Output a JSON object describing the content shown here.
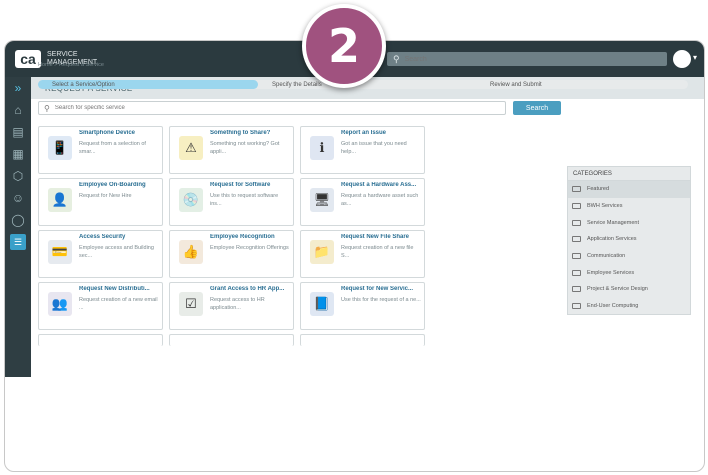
{
  "brand": {
    "logo": "ca",
    "name": "SERVICE MANAGEMENT"
  },
  "global_search": {
    "placeholder": "Search"
  },
  "step_badge": "2",
  "sidebar_icons": [
    "chevron-right-icon",
    "home-icon",
    "document-icon",
    "book-icon",
    "box-icon",
    "users-icon",
    "chat-icon",
    "catalog-icon"
  ],
  "page": {
    "title": "REQUEST A SERVICE",
    "breadcrumb": "Home > Request a Service"
  },
  "steps": [
    "Select a Service/Option",
    "Specify the Details",
    "Review and Submit"
  ],
  "service_search": {
    "placeholder": "Search for specific service",
    "button": "Search"
  },
  "services": [
    {
      "title": "Smartphone Device",
      "desc": "Request from a selection of smar...",
      "icon": "📱",
      "color": "#dfe9f5"
    },
    {
      "title": "Something to Share?",
      "desc": "Something not working? Got appli...",
      "icon": "⚠",
      "color": "#f7efc2"
    },
    {
      "title": "Report an Issue",
      "desc": "Got an issue that you need help...",
      "icon": "ℹ",
      "color": "#dfe6f2"
    },
    {
      "title": "Employee On-Boarding",
      "desc": "Request for New Hire",
      "icon": "👤",
      "color": "#e6efe0"
    },
    {
      "title": "Request for Software",
      "desc": "Use this to request software ins...",
      "icon": "💿",
      "color": "#e3efe5"
    },
    {
      "title": "Request a Hardware Ass...",
      "desc": "Request a hardware asset such as...",
      "icon": "🖥",
      "color": "#e2e8f0"
    },
    {
      "title": "Access Security",
      "desc": "Employee access and Building sec...",
      "icon": "💳",
      "color": "#e6eaef"
    },
    {
      "title": "Employee Recognition",
      "desc": "Employee Recognition Offerings",
      "icon": "👍",
      "color": "#f3e9dc"
    },
    {
      "title": "Request New File Share",
      "desc": "Request creation of a new file S...",
      "icon": "📁",
      "color": "#f4eccd"
    },
    {
      "title": "Request New Distributi...",
      "desc": "Request creation of a new email ...",
      "icon": "👥",
      "color": "#e8e6f0"
    },
    {
      "title": "Grant Access to HR App...",
      "desc": "Request access to HR application...",
      "icon": "☑",
      "color": "#e8ece8"
    },
    {
      "title": "Request for New Servic...",
      "desc": "Use this for the request of a ne...",
      "icon": "📘",
      "color": "#dfe7f3"
    },
    {
      "title": "",
      "desc": "",
      "icon": "",
      "color": "#ffffff"
    },
    {
      "title": "",
      "desc": "",
      "icon": "",
      "color": "#ffffff"
    },
    {
      "title": "",
      "desc": "",
      "icon": "",
      "color": "#ffffff"
    }
  ],
  "categories": {
    "heading": "CATEGORIES",
    "items": [
      "Featured",
      "BWH Services",
      "Service Management",
      "Application Services",
      "Communication",
      "Employee Services",
      "Project & Service Design",
      "End-User Computing"
    ]
  }
}
